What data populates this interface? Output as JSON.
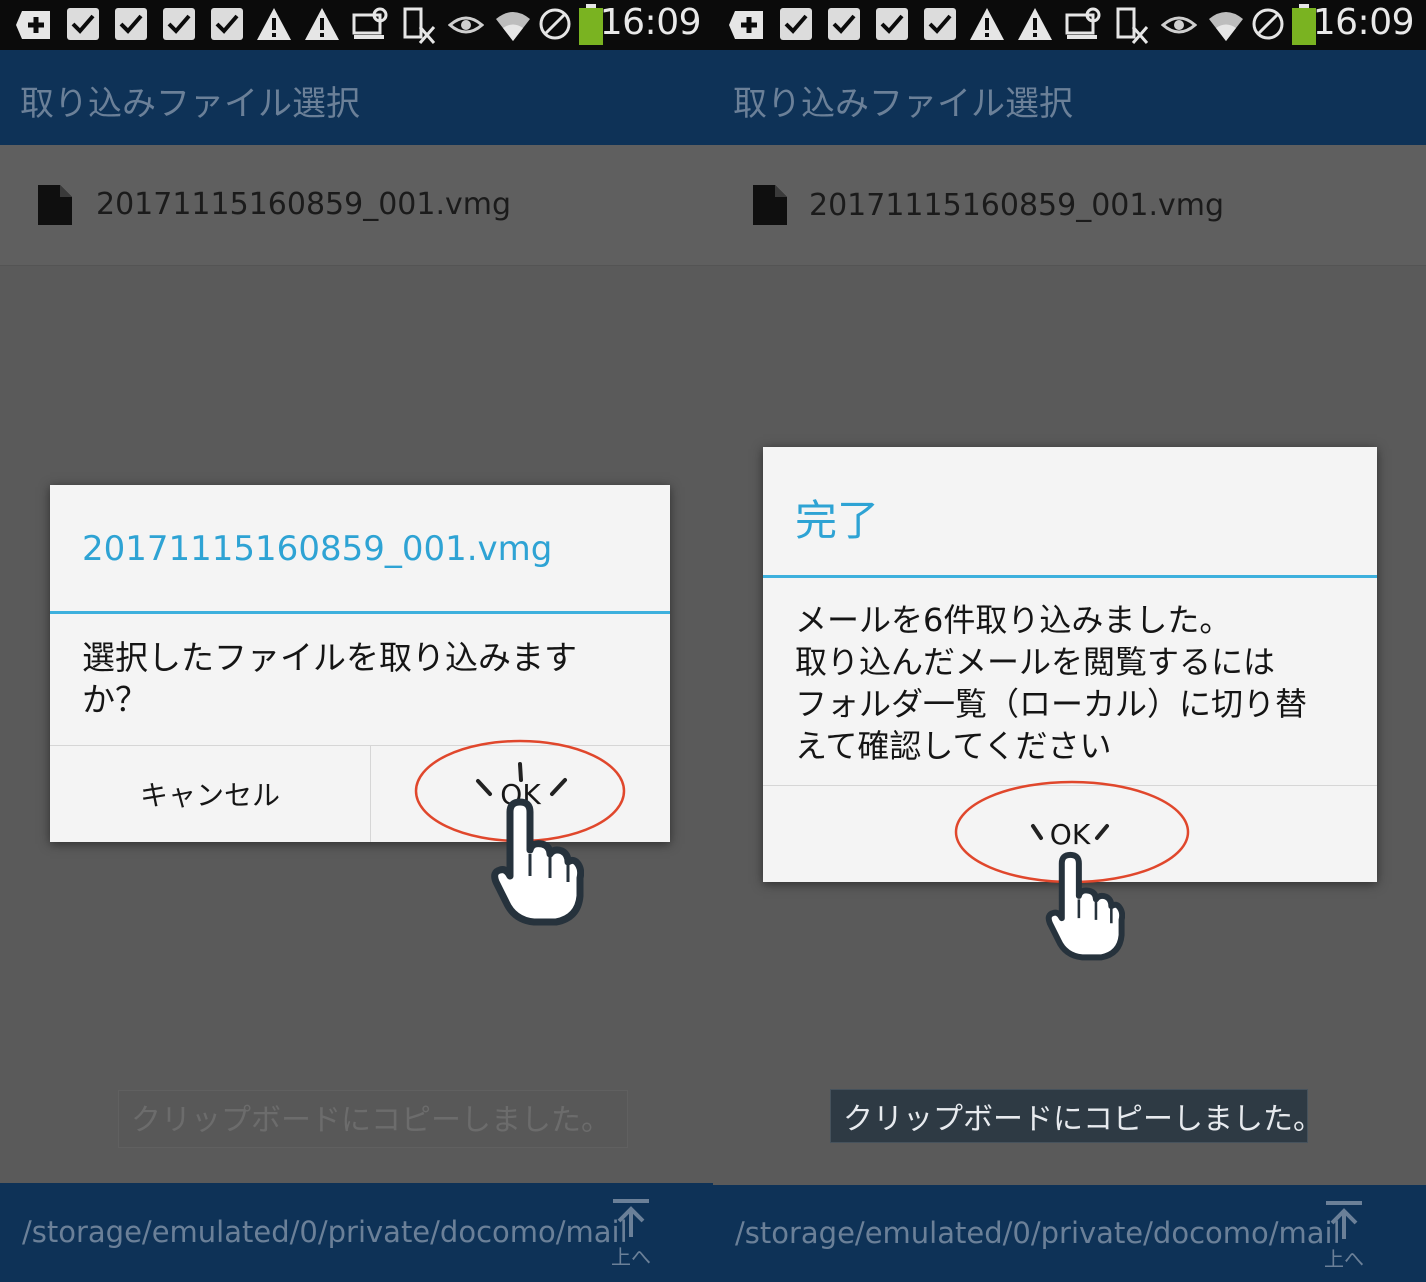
{
  "screens": [
    {
      "status_bar": {
        "time": "16:09"
      },
      "action_bar": {
        "title": "取り込みファイル選択"
      },
      "file_list": [
        {
          "name": "20171115160859_001.vmg"
        }
      ],
      "dialog": {
        "title": "20171115160859_001.vmg",
        "message": "選択したファイルを取り込みます\nか？",
        "cancel_label": "キャンセル",
        "ok_label": "OK"
      },
      "toast": "クリップボードにコピーしました。",
      "path_bar": {
        "path": "/storage/emulated/0/private/docomo/mail",
        "up_label": "上へ"
      }
    },
    {
      "status_bar": {
        "time": "16:09"
      },
      "action_bar": {
        "title": "取り込みファイル選択"
      },
      "file_list": [
        {
          "name": "20171115160859_001.vmg"
        }
      ],
      "dialog": {
        "title": "完了",
        "message": "メールを6件取り込みました。\n取り込んだメールを閲覧するには\nフォルダ一覧（ローカル）に切り替\nえて確認してください",
        "ok_label": "OK"
      },
      "toast": "クリップボードにコピーしました。",
      "path_bar": {
        "path": "/storage/emulated/0/private/docomo/mail",
        "up_label": "上へ"
      }
    }
  ],
  "colors": {
    "action_bar": "#0e3257",
    "dialog_accent": "#2ea3d4",
    "highlight_ring": "#e0472c",
    "battery": "#7ab321"
  },
  "icons": [
    "add-icon",
    "checkbox-icon",
    "warning-icon",
    "sim-icon",
    "input-method-icon",
    "eye-icon",
    "wifi-icon",
    "blocked-icon",
    "battery-icon",
    "file-icon",
    "up-arrow-icon",
    "pointing-hand-icon"
  ]
}
